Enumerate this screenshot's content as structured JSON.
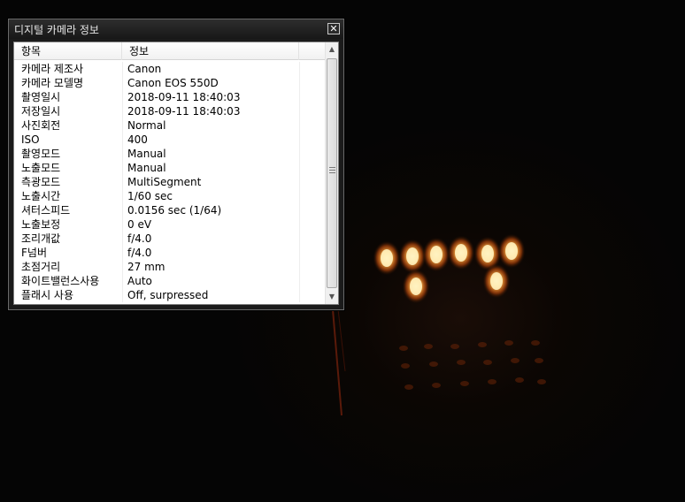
{
  "window": {
    "title": "디지털 카메라 정보",
    "close_glyph": "✕"
  },
  "list": {
    "columns": [
      "항목",
      "정보"
    ],
    "rows": [
      {
        "key": "카메라 제조사",
        "value": "Canon"
      },
      {
        "key": "카메라 모델명",
        "value": "Canon EOS 550D"
      },
      {
        "key": "촬영일시",
        "value": "2018-09-11  18:40:03"
      },
      {
        "key": "저장일시",
        "value": "2018-09-11  18:40:03"
      },
      {
        "key": "사진회전",
        "value": "Normal"
      },
      {
        "key": "ISO",
        "value": "400"
      },
      {
        "key": "촬영모드",
        "value": "Manual"
      },
      {
        "key": "노출모드",
        "value": "Manual"
      },
      {
        "key": "측광모드",
        "value": "MultiSegment"
      },
      {
        "key": "노출시간",
        "value": "1/60 sec"
      },
      {
        "key": "셔터스피드",
        "value": "0.0156 sec  (1/64)"
      },
      {
        "key": "노출보정",
        "value": "0 eV"
      },
      {
        "key": "조리개값",
        "value": "f/4.0"
      },
      {
        "key": "F넘버",
        "value": "f/4.0"
      },
      {
        "key": "초점거리",
        "value": "27 mm"
      },
      {
        "key": "화이트밸런스사용",
        "value": "Auto"
      },
      {
        "key": "플래시 사용",
        "value": "Off, surpressed"
      }
    ]
  },
  "scrollbar": {
    "up_glyph": "▲",
    "down_glyph": "▼"
  },
  "colors": {
    "flame": "#ffb347",
    "flame_core": "#fff2c0"
  }
}
